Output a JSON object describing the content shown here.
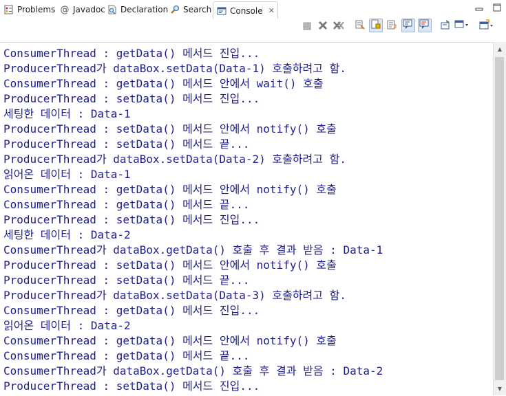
{
  "tabs": [
    {
      "label": "Problems",
      "icon": "problems-icon"
    },
    {
      "label": "Javadoc",
      "icon": "javadoc-icon"
    },
    {
      "label": "Declaration",
      "icon": "declaration-icon"
    },
    {
      "label": "Search",
      "icon": "search-icon"
    },
    {
      "label": "Console",
      "icon": "console-icon",
      "active": true
    }
  ],
  "colors": {
    "console_text": "#1d1d8c",
    "tab_border": "#cfcfcf",
    "pressed_button": "#dde7f3"
  },
  "console": {
    "lines": [
      "ConsumerThread : getData() 메서드 진입...",
      "ProducerThread가 dataBox.setData(Data-1) 호출하려고 함.",
      "ConsumerThread : getData() 메서드 안에서 wait() 호출",
      "ProducerThread : setData() 메서드 진입...",
      "세팅한 데이터 : Data-1",
      "ProducerThread : setData() 메서드 안에서 notify() 호출",
      "ProducerThread : setData() 메서드 끝...",
      "ProducerThread가 dataBox.setData(Data-2) 호출하려고 함.",
      "읽어온 데이터 : Data-1",
      "ConsumerThread : getData() 메서드 안에서 notify() 호출",
      "ConsumerThread : getData() 메서드 끝...",
      "ProducerThread : setData() 메서드 진입...",
      "세팅한 데이터 : Data-2",
      "ConsumerThread가 dataBox.getData() 호출 후 결과 받음 : Data-1",
      "ProducerThread : setData() 메서드 안에서 notify() 호출",
      "ProducerThread : setData() 메서드 끝...",
      "ProducerThread가 dataBox.setData(Data-3) 호출하려고 함.",
      "ConsumerThread : getData() 메서드 진입...",
      "읽어온 데이터 : Data-2",
      "ConsumerThread : getData() 메서드 안에서 notify() 호출",
      "ConsumerThread : getData() 메서드 끝...",
      "ConsumerThread가 dataBox.getData() 호출 후 결과 받음 : Data-2",
      "ProducerThread : setData() 메서드 진입..."
    ]
  }
}
